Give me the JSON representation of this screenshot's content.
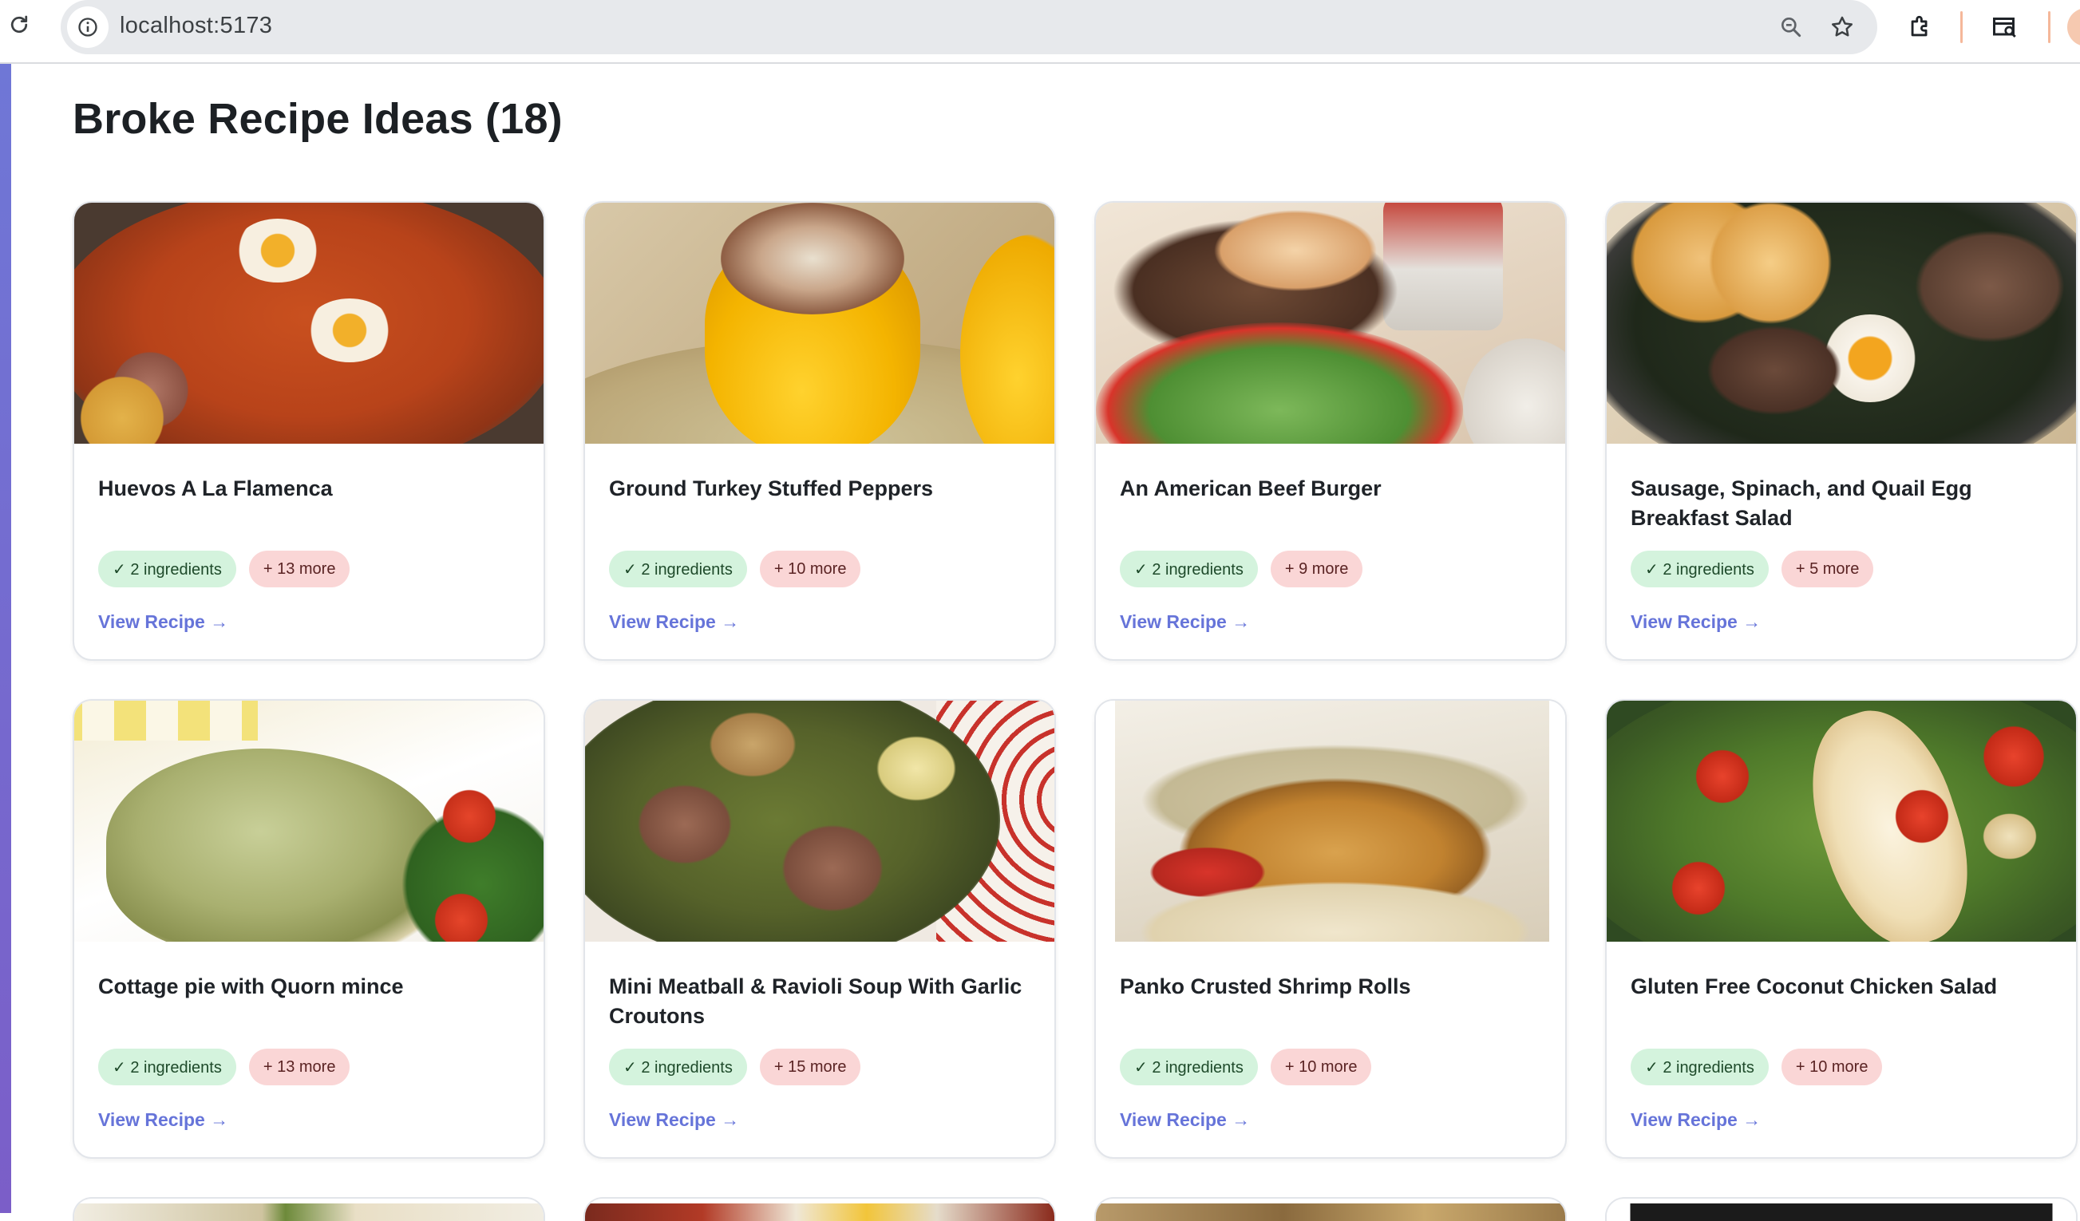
{
  "browser": {
    "url": "localhost:5173",
    "icons": {
      "reload": "reload-icon",
      "site_info": "info-icon",
      "zoom": "zoom-icon",
      "bookmark": "star-icon",
      "extensions": "puzzle-icon",
      "tab_search": "tab-search-icon",
      "profile": "avatar"
    }
  },
  "page": {
    "title": "Broke Recipe Ideas (18)",
    "accent_color": "#6674d9"
  },
  "recipes": [
    {
      "title": "Huevos A La Flamenca",
      "have": "✓ 2 ingredients",
      "missing": "+ 13 more",
      "link": "View Recipe →"
    },
    {
      "title": "Ground Turkey Stuffed Peppers",
      "have": "✓ 2 ingredients",
      "missing": "+ 10 more",
      "link": "View Recipe →"
    },
    {
      "title": "An American Beef Burger",
      "have": "✓ 2 ingredients",
      "missing": "+ 9 more",
      "link": "View Recipe →"
    },
    {
      "title": "Sausage, Spinach, and Quail Egg Breakfast Salad",
      "have": "✓ 2 ingredients",
      "missing": "+ 5 more",
      "link": "View Recipe →"
    },
    {
      "title": "Cottage pie with Quorn mince",
      "have": "✓ 2 ingredients",
      "missing": "+ 13 more",
      "link": "View Recipe →"
    },
    {
      "title": "Mini Meatball & Ravioli Soup With Garlic Croutons",
      "have": "✓ 2 ingredients",
      "missing": "+ 15 more",
      "link": "View Recipe →"
    },
    {
      "title": "Panko Crusted Shrimp Rolls",
      "have": "✓ 2 ingredients",
      "missing": "+ 10 more",
      "link": "View Recipe →"
    },
    {
      "title": "Gluten Free Coconut Chicken Salad",
      "have": "✓ 2 ingredients",
      "missing": "+ 10 more",
      "link": "View Recipe →"
    }
  ]
}
